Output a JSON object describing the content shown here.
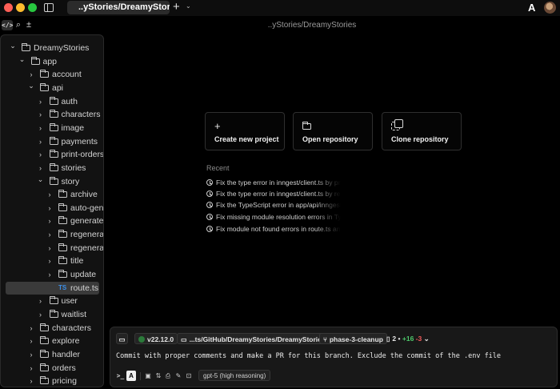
{
  "window": {
    "tab_title": "..yStories/DreamyStories",
    "new_tab_glyph": "+",
    "tab_menu_glyph": "⌄",
    "app_logo": "A"
  },
  "toolbar": {
    "code_icon": "</>",
    "find_icon": "⌕",
    "extension_icon": "±"
  },
  "header": {
    "path": "..yStories/DreamyStories"
  },
  "tree": {
    "items": [
      {
        "label": "DreamyStories",
        "kind": "folder",
        "expanded": true
      },
      {
        "label": "app",
        "kind": "folder",
        "expanded": true
      },
      {
        "label": "account",
        "kind": "folder",
        "expanded": false
      },
      {
        "label": "api",
        "kind": "folder",
        "expanded": true
      },
      {
        "label": "auth",
        "kind": "folder",
        "expanded": false
      },
      {
        "label": "characters",
        "kind": "folder",
        "expanded": false
      },
      {
        "label": "image",
        "kind": "folder",
        "expanded": false
      },
      {
        "label": "payments",
        "kind": "folder",
        "expanded": false
      },
      {
        "label": "print-orders",
        "kind": "folder",
        "expanded": false
      },
      {
        "label": "stories",
        "kind": "folder",
        "expanded": false
      },
      {
        "label": "story",
        "kind": "folder",
        "expanded": true
      },
      {
        "label": "archive",
        "kind": "folder",
        "expanded": false
      },
      {
        "label": "auto-generate",
        "kind": "folder",
        "expanded": false
      },
      {
        "label": "generate",
        "kind": "folder",
        "expanded": false
      },
      {
        "label": "regenerate",
        "kind": "folder",
        "expanded": false
      },
      {
        "label": "regenerate",
        "kind": "folder",
        "expanded": false
      },
      {
        "label": "title",
        "kind": "folder",
        "expanded": false
      },
      {
        "label": "update",
        "kind": "folder",
        "expanded": false
      },
      {
        "label": "route.ts",
        "kind": "file",
        "badge": "TS",
        "selected": true
      },
      {
        "label": "user",
        "kind": "folder",
        "expanded": false
      },
      {
        "label": "waitlist",
        "kind": "folder",
        "expanded": false
      },
      {
        "label": "characters",
        "kind": "folder",
        "expanded": false
      },
      {
        "label": "explore",
        "kind": "folder",
        "expanded": false
      },
      {
        "label": "handler",
        "kind": "folder",
        "expanded": false
      },
      {
        "label": "orders",
        "kind": "folder",
        "expanded": false
      },
      {
        "label": "pricing",
        "kind": "folder",
        "expanded": false
      }
    ]
  },
  "actions": {
    "create_label": "Create new project",
    "create_glyph": "+",
    "open_label": "Open repository",
    "clone_label": "Clone repository"
  },
  "recent": {
    "heading": "Recent",
    "items": [
      "Fix the type error in inngest/client.ts by providing the correct options",
      "Fix the type error in inngest/client.ts by removing the unused property",
      "Fix the TypeScript error in app/api/inngest/route.ts",
      "Fix missing module resolution errors in TypeScript",
      "Fix module not found errors in route.ts and related files"
    ]
  },
  "composer": {
    "chat_icon": "▭",
    "node_version": "v22.12.0",
    "path": "...ts/GitHub/DreamyStories/DreamyStories",
    "branch": "phase-3-cleanup",
    "changed_files": "2",
    "bullet": "•",
    "additions": "+16",
    "deletions": "-3",
    "chevron": "⌄",
    "prompt": "Commit with proper comments and make a PR for this branch. Exclude the commit of the .env file",
    "terminal_glyph": ">_",
    "agent_glyph": "A",
    "tool_glyphs": [
      "▣",
      "⇅",
      "⎙",
      "✎",
      "⊡"
    ],
    "model": "gpt-5 (high reasoning)"
  }
}
